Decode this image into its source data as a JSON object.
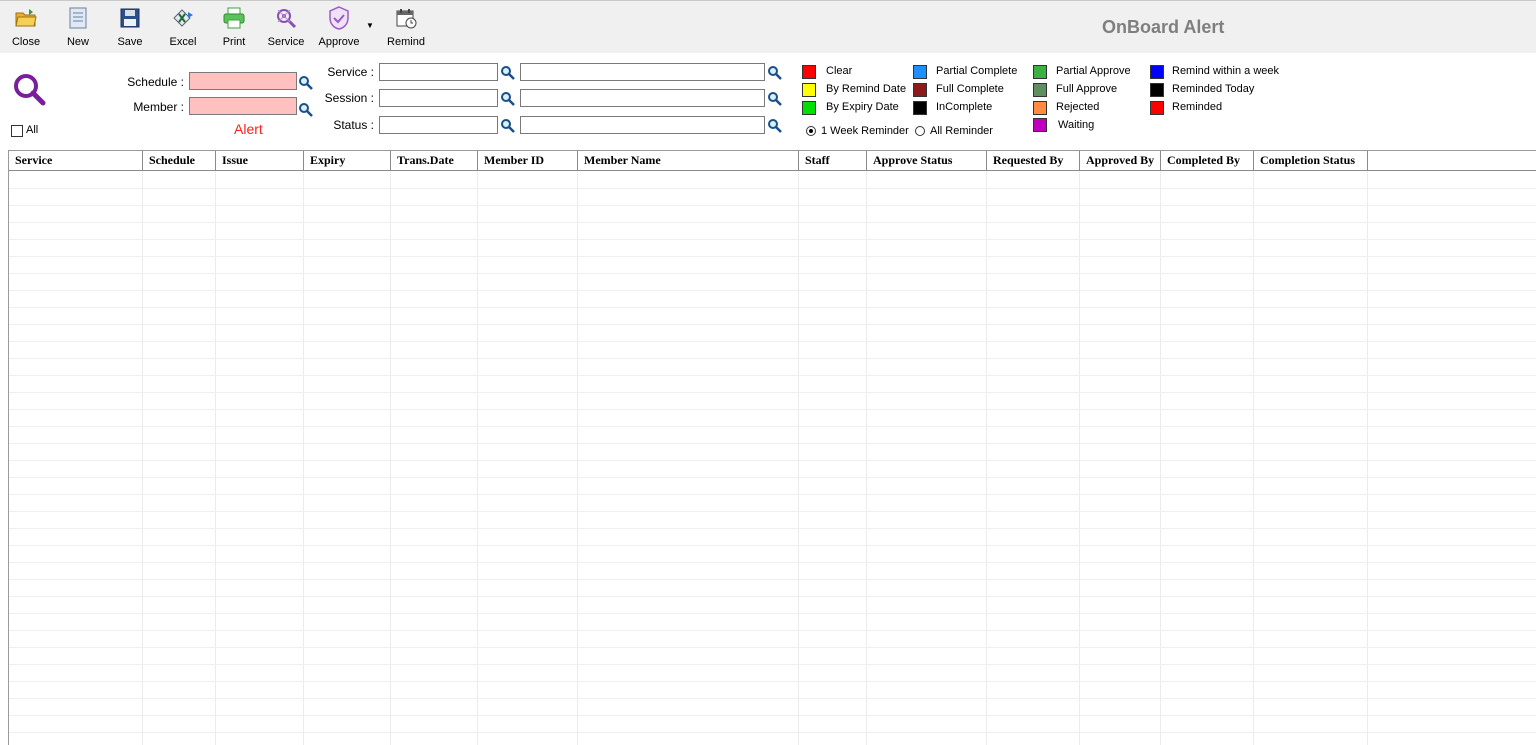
{
  "toolbar": {
    "close": "Close",
    "new": "New",
    "save": "Save",
    "excel": "Excel",
    "print": "Print",
    "service": "Service",
    "approve": "Approve",
    "remind": "Remind"
  },
  "title": "OnBoard Alert",
  "filters": {
    "schedule_label": "Schedule :",
    "member_label": "Member :",
    "alert_text": "Alert",
    "all_label": "All",
    "service_label": "Service :",
    "session_label": "Session :",
    "status_label": "Status :"
  },
  "legend": {
    "items": [
      {
        "label": "Clear",
        "color": "#ff0000"
      },
      {
        "label": "By Remind Date",
        "color": "#ffff00"
      },
      {
        "label": "By Expiry Date",
        "color": "#00e000"
      },
      {
        "label": "Partial Complete",
        "color": "#1e90ff"
      },
      {
        "label": "Full Complete",
        "color": "#8b1a1a"
      },
      {
        "label": "InComplete",
        "color": "#000000"
      },
      {
        "label": "Partial Approve",
        "color": "#3cb043"
      },
      {
        "label": "Full Approve",
        "color": "#5f8f5f"
      },
      {
        "label": "Rejected",
        "color": "#ff8c40"
      },
      {
        "label": "Waiting",
        "color": "#c000c0"
      },
      {
        "label": "Remind within a week",
        "color": "#0000ff"
      },
      {
        "label": "Reminded Today",
        "color": "#000000"
      },
      {
        "label": "Reminded",
        "color": "#ff0000"
      }
    ],
    "radio_week": "1 Week Reminder",
    "radio_all": "All Reminder",
    "selected": "1 Week Reminder"
  },
  "table": {
    "columns": [
      "Service",
      "Schedule",
      "Issue",
      "Expiry",
      "Trans.Date",
      "Member ID",
      "Member Name",
      "Staff",
      "Approve Status",
      "Requested By",
      "Approved By",
      "Completed By",
      "Completion Status"
    ],
    "rows": []
  }
}
